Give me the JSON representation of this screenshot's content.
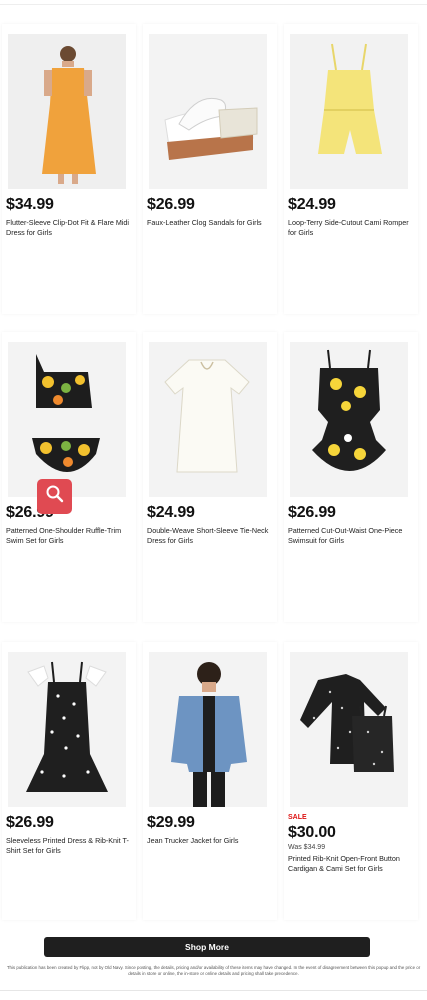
{
  "products": [
    {
      "price": "$34.99",
      "name": "Flutter-Sleeve Clip-Dot Fit & Flare Midi Dress for Girls",
      "image": "orange-dress-photo"
    },
    {
      "price": "$26.99",
      "name": "Faux-Leather Clog Sandals for Girls",
      "image": "white-clog-sandal-photo"
    },
    {
      "price": "$24.99",
      "name": "Loop-Terry Side-Cutout Cami Romper for Girls",
      "image": "yellow-romper-photo"
    },
    {
      "price": "$26.99",
      "name": "Patterned One-Shoulder Ruffle-Trim Swim Set for Girls",
      "image": "floral-bikini-photo"
    },
    {
      "price": "$24.99",
      "name": "Double-Weave Short-Sleeve Tie-Neck Dress for Girls",
      "image": "white-dress-photo"
    },
    {
      "price": "$26.99",
      "name": "Patterned Cut-Out-Waist One-Piece Swimsuit for Girls",
      "image": "daisy-swimsuit-photo"
    },
    {
      "price": "$26.99",
      "name": "Sleeveless Printed Dress & Rib-Knit T-Shirt Set for Girls",
      "image": "black-polka-dress-photo"
    },
    {
      "price": "$29.99",
      "name": "Jean Trucker Jacket for Girls",
      "image": "denim-jacket-photo"
    },
    {
      "price": "$30.00",
      "name": "Printed Rib-Knit Open-Front Button Cardigan & Cami Set for Girls",
      "sale_label": "SALE",
      "was_price": "Was $34.99",
      "image": "black-cardigan-set-photo"
    }
  ],
  "search_badge_icon": "search-icon",
  "accent_color": "#e04a52",
  "shop_more_label": "Shop More",
  "disclaimer": "This publication has been created by Flipp, not by Old Navy. Since posting, the details, pricing and/or availability of these items may have changed. In the event of disagreement between this popup and the price or details in store or online, the in-store or online details and pricing shall take precedence."
}
